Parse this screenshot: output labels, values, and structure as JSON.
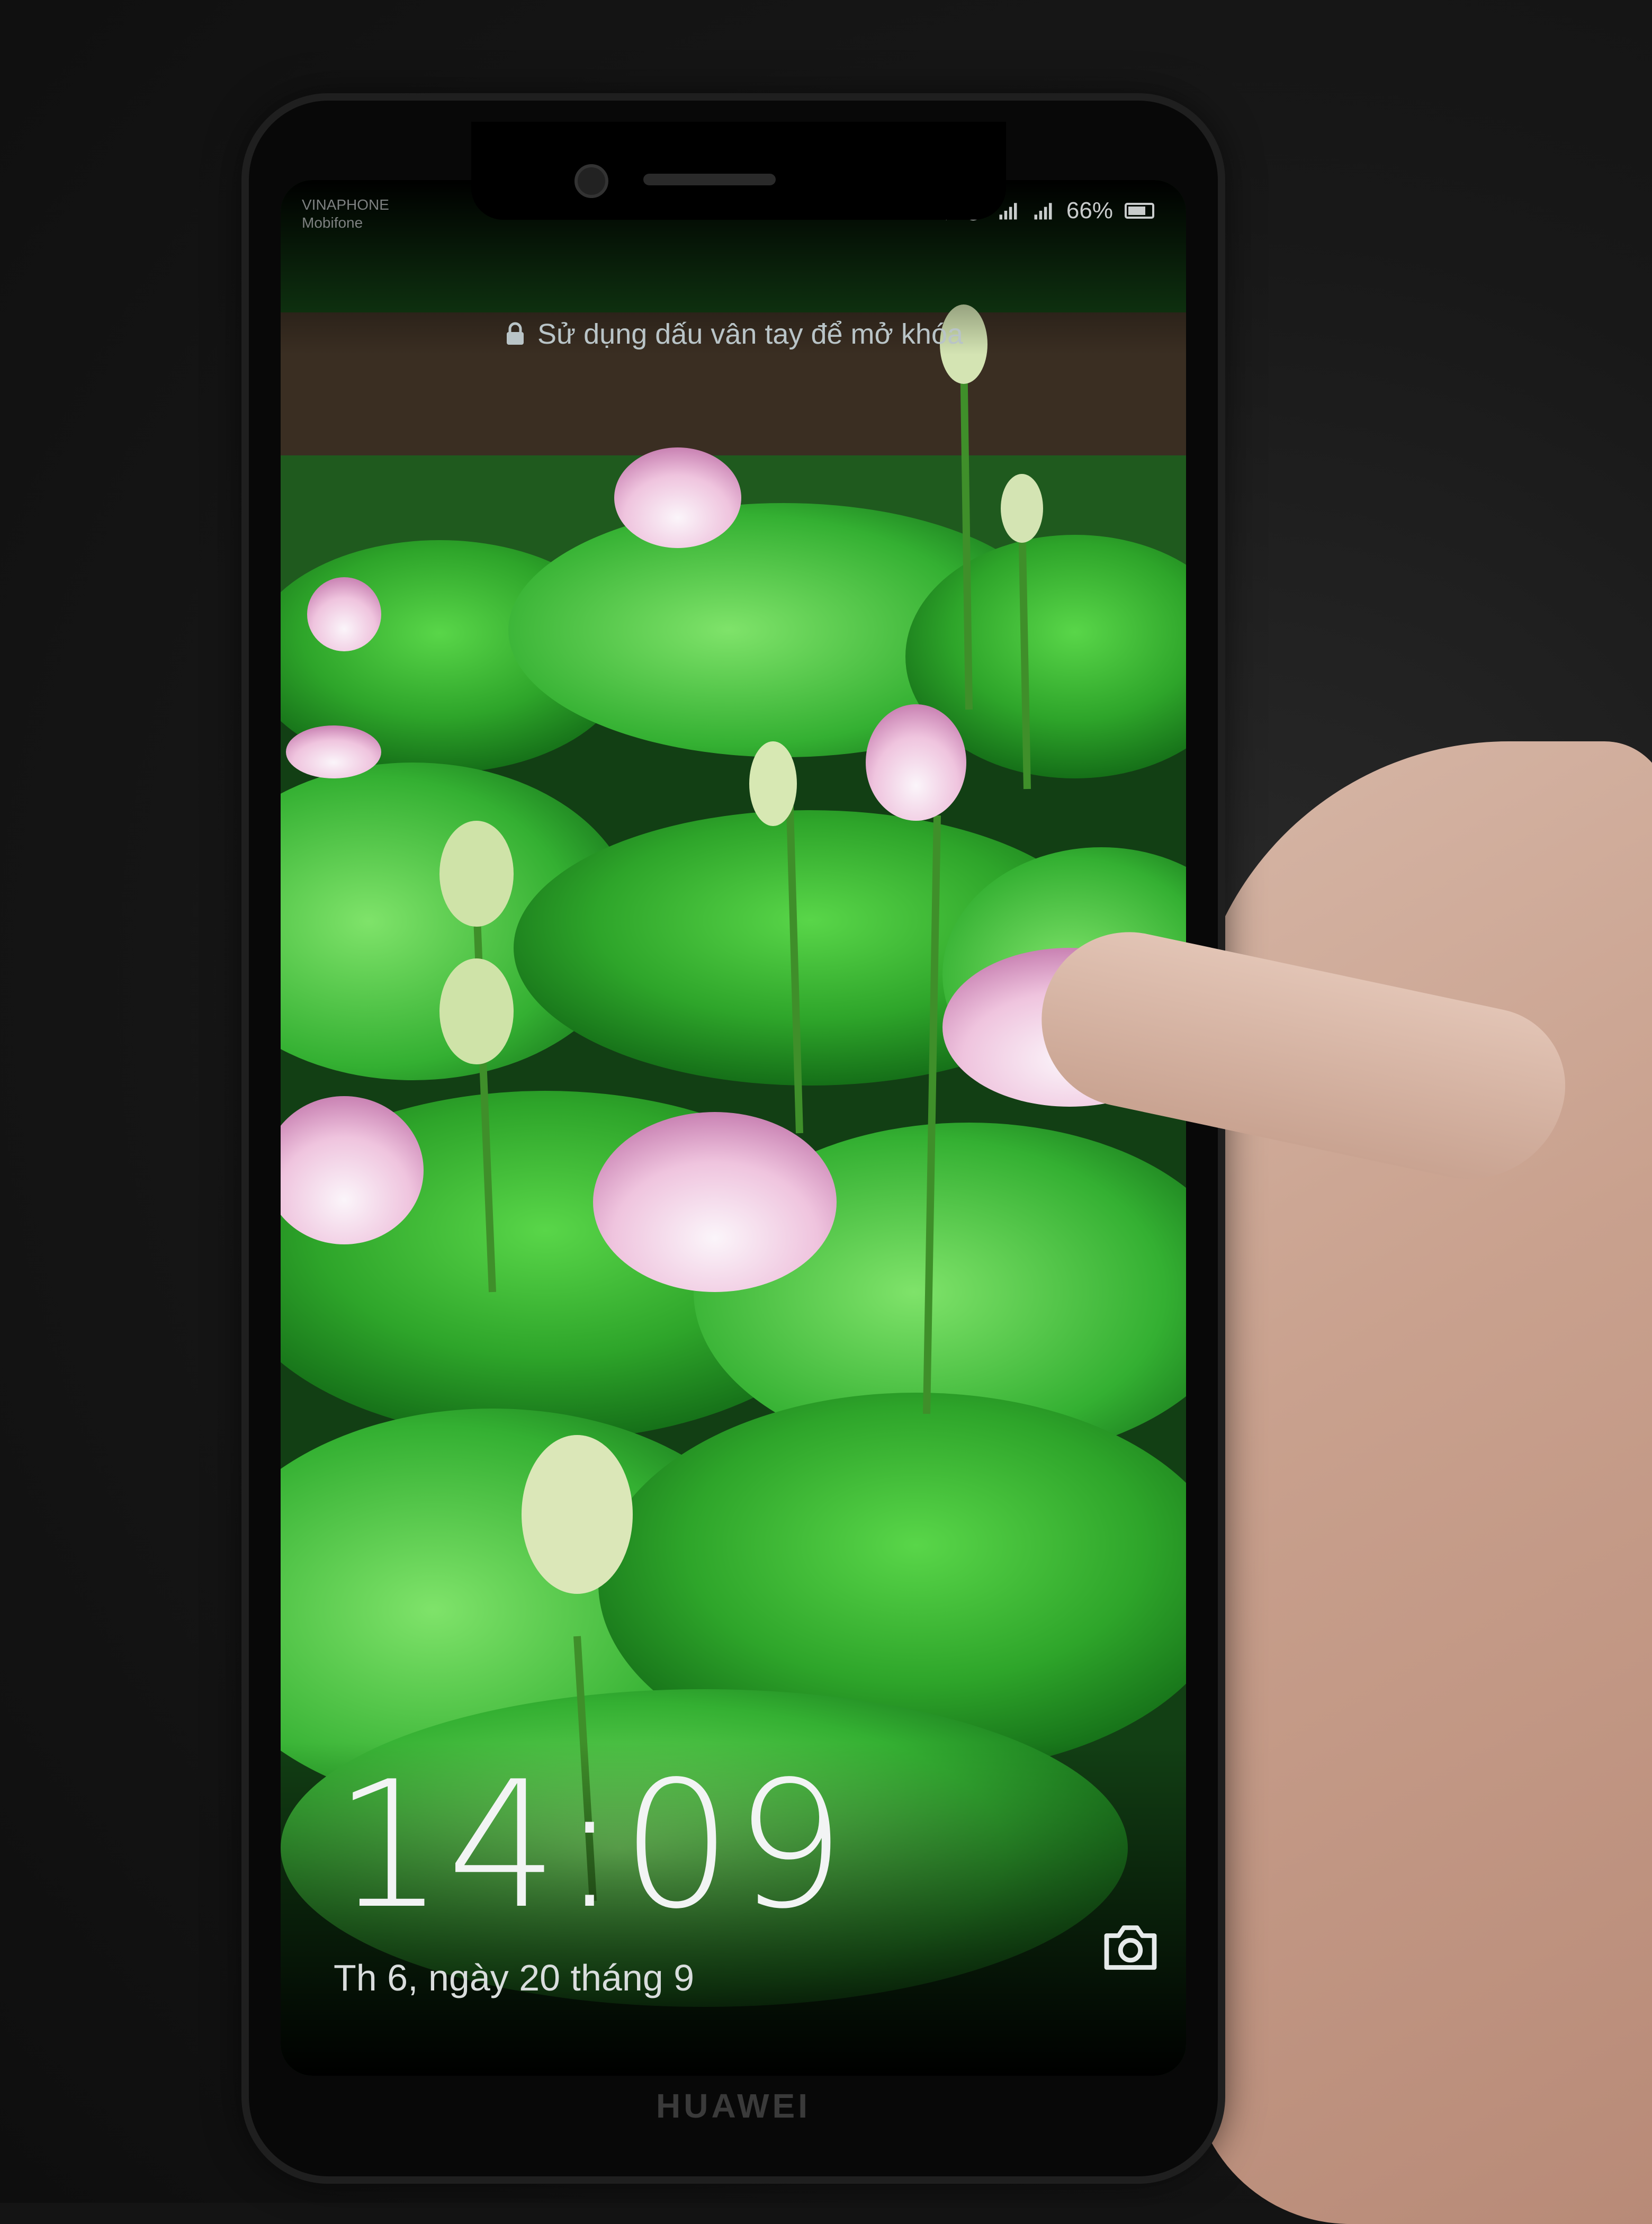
{
  "carrier": {
    "line1": "VINAPHONE",
    "line2": "Mobifone"
  },
  "status_bar": {
    "icons": [
      "mute-icon",
      "alarm-icon",
      "signal-icon",
      "signal-icon"
    ],
    "battery_percent_label": "66%",
    "battery_level": 0.66
  },
  "lockscreen": {
    "unlock_hint": "Sử dụng dấu vân tay để mở khóa",
    "time": "14:09",
    "date": "Th 6, ngày 20 tháng 9",
    "shortcut_icon": "camera-icon"
  },
  "device": {
    "brand": "HUAWEI"
  },
  "colors": {
    "lotus_leaf": "#2fae2f",
    "lotus_pink": "#e9b3d2",
    "text": "#f2f4f4"
  }
}
